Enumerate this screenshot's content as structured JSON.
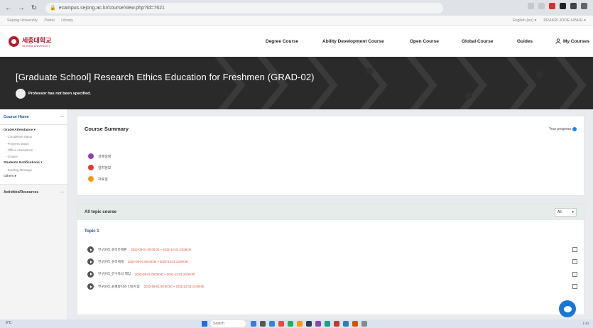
{
  "browser": {
    "url": "ecampus.sejong.ac.kr/course/view.php?id=7621",
    "extension_colors": [
      "#c9c9c9",
      "#c9c9c9",
      "#d32f2f",
      "#222222",
      "#444444",
      "#666666"
    ]
  },
  "utility_bar": {
    "left_links": [
      "Sejong University",
      "Portal",
      "Library"
    ],
    "language": "English (en) ▾",
    "user": "PRAKRI JOOE HWHE ▾"
  },
  "header": {
    "logo_korean": "세종대학교",
    "logo_english": "SEJONG UNIVERSITY",
    "nav": [
      {
        "label": "Degree Course"
      },
      {
        "label": "Ability Development Course"
      },
      {
        "label": "Open Course"
      },
      {
        "label": "Global Course"
      },
      {
        "label": "Guides"
      },
      {
        "label": "My Courses"
      }
    ]
  },
  "banner": {
    "title": "[Graduate School] Research Ethics Education for Freshmen (GRAD-02)",
    "professor": "Professor has not been specified."
  },
  "sidebar": {
    "home": "Course Home",
    "grade_attendance": "Grade/Attendance ▾",
    "grade_items": [
      "- Completion status",
      "- Progress status",
      "- Offline-Attendance",
      "- Grades"
    ],
    "notifications": "Students Notifications ▾",
    "notification_items": [
      "- Sending Message"
    ],
    "others": "Others ▸",
    "activities": "Activities/Resources"
  },
  "summary": {
    "title": "Course Summary",
    "progress_label": "Your progress",
    "legend": [
      {
        "label": "과제설정",
        "color": "#8e44ad"
      },
      {
        "label": "알려정보",
        "color": "#e53935"
      },
      {
        "label": "자료설",
        "color": "#f39c12"
      }
    ]
  },
  "topics": {
    "header": "All topic course",
    "filter_value": "All",
    "topic_title": "Topic 1",
    "items": [
      {
        "name": "연구윤리_윤리문제편",
        "date": "2022-09-01 00:00:00 ~ 2022-12-31 23:59:00"
      },
      {
        "name": "연구윤리_윤리체계",
        "date": "2022-09-01 00:00:00 ~ 2022-12-31 23:59:00"
      },
      {
        "name": "연구윤리_연구자의 책임",
        "date": "2022-09-01 00:00:00 ~ 2022-12-31 23:59:00"
      },
      {
        "name": "연구윤리_표절방지와 인용지침",
        "date": "2022-09-01 00:00:00 ~ 2022-12-31 23:59:00"
      }
    ]
  },
  "taskbar": {
    "weather": "9°C",
    "search": "Search",
    "clock": "1:43",
    "app_colors": [
      "#3a7bd5",
      "#555555",
      "#2e86de",
      "#e74c3c",
      "#27ae60",
      "#f39c12",
      "#2c3e50",
      "#8e44ad",
      "#16a085",
      "#c0392b",
      "#2980b9",
      "#d35400",
      "#7f8c8d"
    ]
  }
}
